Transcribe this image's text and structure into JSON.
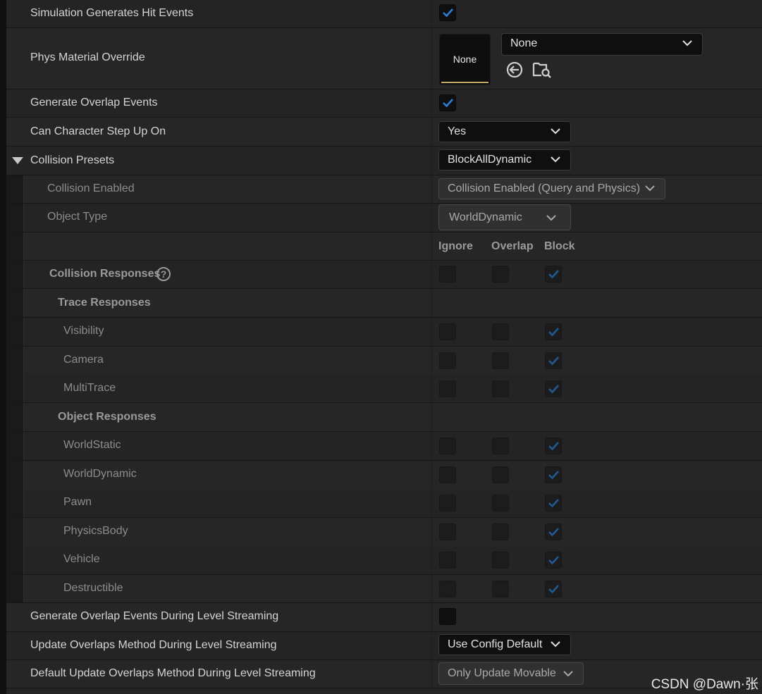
{
  "rows": {
    "sim_hit": {
      "label": "Simulation Generates Hit Events",
      "checked": true
    },
    "phys_mat": {
      "label": "Phys Material Override",
      "thumb_label": "None",
      "dropdown": "None"
    },
    "gen_overlap": {
      "label": "Generate Overlap Events",
      "checked": true
    },
    "step_up": {
      "label": "Can Character Step Up On",
      "dropdown": "Yes"
    },
    "presets": {
      "label": "Collision Presets",
      "dropdown": "BlockAllDynamic"
    },
    "coll_enabled": {
      "label": "Collision Enabled",
      "dropdown": "Collision Enabled (Query and Physics)"
    },
    "obj_type": {
      "label": "Object Type",
      "dropdown": "WorldDynamic"
    },
    "resp_header": {
      "ignore": "Ignore",
      "overlap": "Overlap",
      "block": "Block"
    },
    "coll_responses": {
      "label": "Collision Responses",
      "help": "?"
    },
    "trace_responses": {
      "label": "Trace Responses"
    },
    "object_responses": {
      "label": "Object Responses"
    },
    "gen_overlap_stream": {
      "label": "Generate Overlap Events During Level Streaming",
      "checked": false
    },
    "update_overlaps": {
      "label": "Update Overlaps Method During Level Streaming",
      "dropdown": "Use Config Default"
    },
    "default_update": {
      "label": "Default Update Overlaps Method During Level Streaming",
      "dropdown": "Only Update Movable"
    }
  },
  "trace_channels": [
    {
      "name": "Visibility",
      "response": "Block"
    },
    {
      "name": "Camera",
      "response": "Block"
    },
    {
      "name": "MultiTrace",
      "response": "Block"
    }
  ],
  "object_channels": [
    {
      "name": "WorldStatic",
      "response": "Block"
    },
    {
      "name": "WorldDynamic",
      "response": "Block"
    },
    {
      "name": "Pawn",
      "response": "Block"
    },
    {
      "name": "PhysicsBody",
      "response": "Block"
    },
    {
      "name": "Vehicle",
      "response": "Block"
    },
    {
      "name": "Destructible",
      "response": "Block"
    }
  ],
  "icons": {
    "browse": "arrow-left-circle-icon",
    "find": "folder-search-icon",
    "chevron": "chevron-down-icon",
    "expand": "triangle-down-icon"
  },
  "colors": {
    "check_active": "#2a7fd8",
    "check_disabled": "#1f5a93",
    "thumb_bar": "#c4a96b"
  },
  "watermark": "CSDN @Dawn·张"
}
